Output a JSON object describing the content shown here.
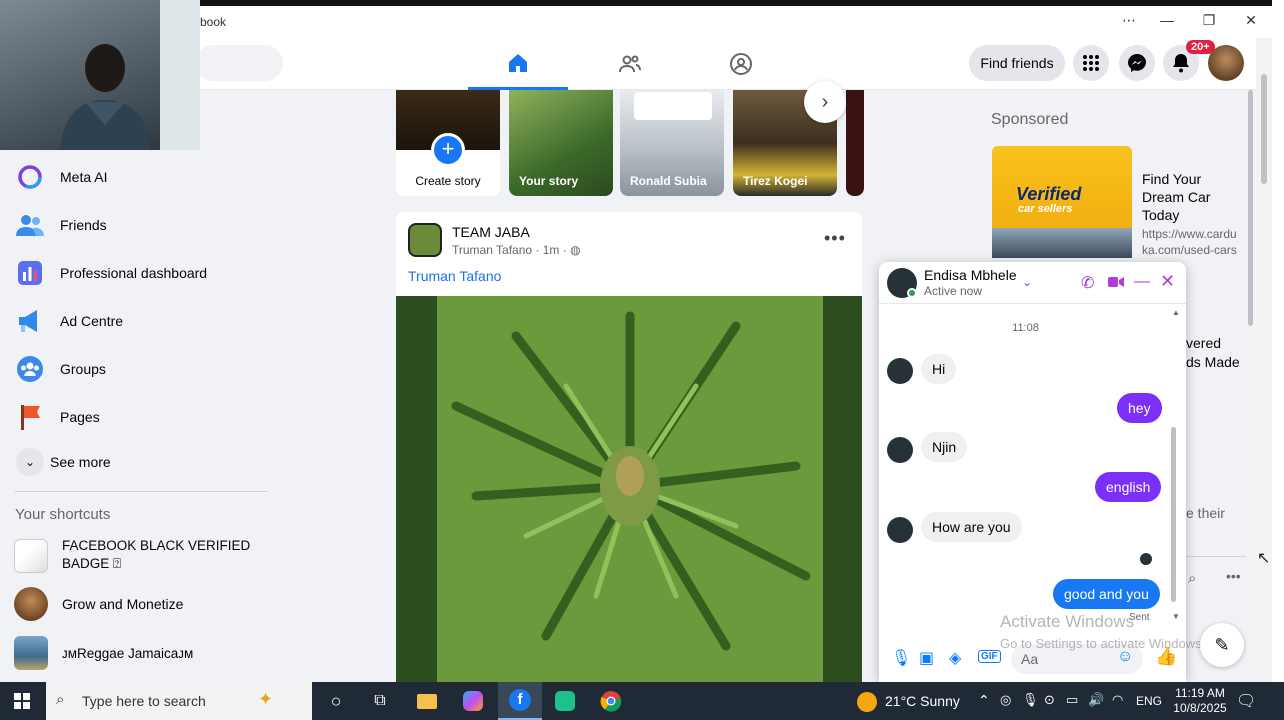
{
  "window": {
    "title": "book"
  },
  "header": {
    "find_friends": "Find friends",
    "notif_badge": "20+"
  },
  "sidebar": {
    "items": [
      {
        "label": "Meta AI",
        "icon": "meta-ai-icon"
      },
      {
        "label": "Friends",
        "icon": "friends-icon"
      },
      {
        "label": "Professional dashboard",
        "icon": "dashboard-icon"
      },
      {
        "label": "Ad Centre",
        "icon": "megaphone-icon"
      },
      {
        "label": "Groups",
        "icon": "groups-icon"
      },
      {
        "label": "Pages",
        "icon": "flag-icon"
      }
    ],
    "see_more": "See more",
    "shortcuts_title": "Your shortcuts",
    "shortcuts": [
      {
        "label": "FACEBOOK BLACK VERIFIED BADGE ⍰"
      },
      {
        "label": "Grow and Monetize"
      },
      {
        "label": "ᴊᴍReggae Jamaicaᴊᴍ"
      }
    ]
  },
  "stories": {
    "create_label": "Create story",
    "items": [
      {
        "label": "Your story"
      },
      {
        "label": "Ronald Subia"
      },
      {
        "label": "Tirez Kogei"
      }
    ]
  },
  "post": {
    "group": "TEAM JABA",
    "author": "Truman Tafano",
    "time": "1m",
    "text": "Truman Tafano"
  },
  "right": {
    "sponsored": "Sponsored",
    "ad_title": "Find Your Dream Car Today",
    "ad_url": "https://www.carduka.com/used-cars",
    "ad_logo_line1": "Verified",
    "ad_logo_line2": "car sellers",
    "partial1": "vered",
    "partial2": "ds Made",
    "partial3": "e their"
  },
  "chat": {
    "name": "Endisa Mbhele",
    "status": "Active now",
    "time": "11:08",
    "messages": [
      {
        "dir": "in",
        "text": "Hi"
      },
      {
        "dir": "out",
        "text": "hey"
      },
      {
        "dir": "in",
        "text": "Njin"
      },
      {
        "dir": "out",
        "text": "english"
      },
      {
        "dir": "in",
        "text": "How are you"
      },
      {
        "dir": "out",
        "text": "good and you"
      }
    ],
    "sent": "Sent",
    "composer_placeholder": "Aa"
  },
  "watermark": {
    "line1": "Activate Windows",
    "line2": "Go to Settings to activate Windows."
  },
  "taskbar": {
    "search_placeholder": "Type here to search",
    "weather": "21°C  Sunny",
    "lang": "ENG",
    "time": "11:19 AM",
    "date": "10/8/2025"
  }
}
